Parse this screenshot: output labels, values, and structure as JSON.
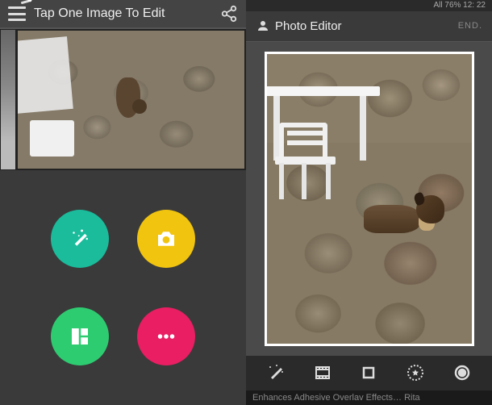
{
  "left": {
    "title": "Tap One Image To Edit",
    "buttons": {
      "magic": "magic-wand",
      "camera": "camera",
      "collage": "collage",
      "more": "more"
    }
  },
  "right": {
    "status": "All 76% 12: 22",
    "title": "Photo Editor",
    "end_label": "END.",
    "footer": "Enhances Adhesive Overlav Effects… Rita",
    "tools": {
      "wand": "magic-wand",
      "film": "filmstrip",
      "crop": "crop",
      "star": "star-badge",
      "vignette": "vignette"
    }
  },
  "colors": {
    "teal": "#1abc9c",
    "yellow": "#f1c40f",
    "green": "#2ecc71",
    "pink": "#e91e63"
  }
}
